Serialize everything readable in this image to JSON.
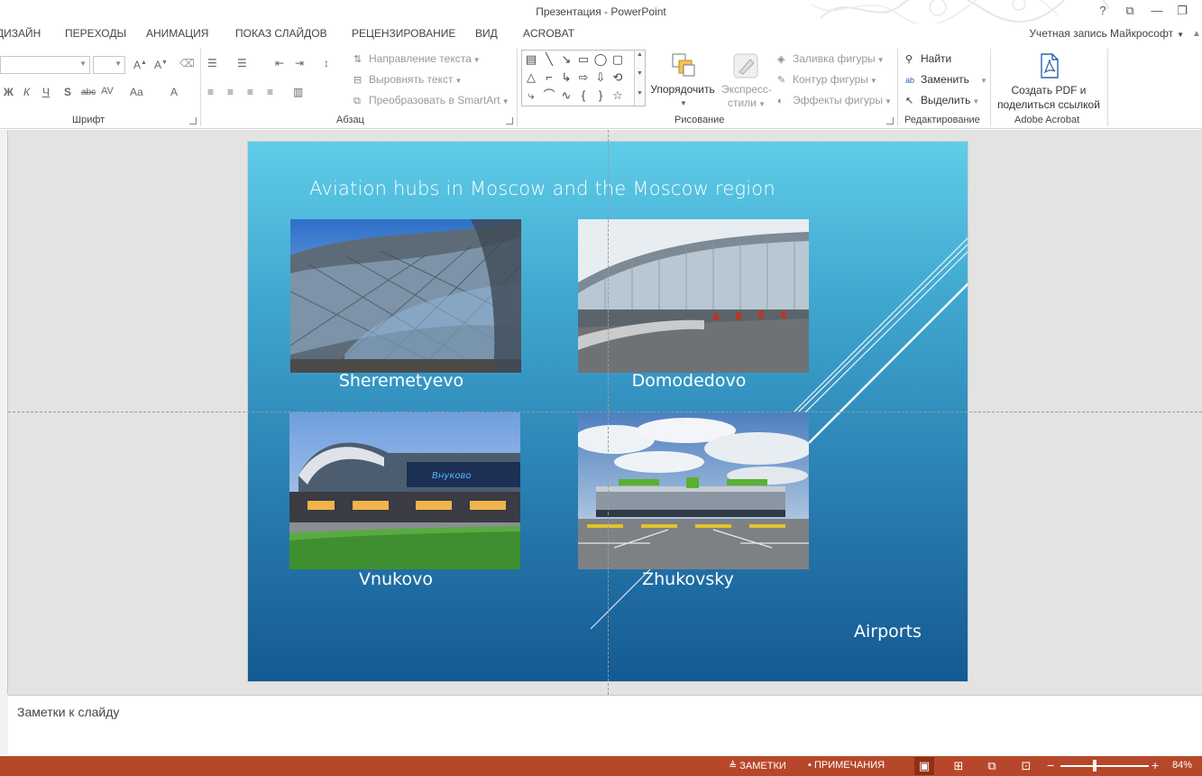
{
  "window": {
    "title": "Презентация - PowerPoint",
    "controls": [
      "?",
      "⧉",
      "—",
      "❐"
    ]
  },
  "ribbon_tabs": [
    "ДИЗАЙН",
    "ПЕРЕХОДЫ",
    "АНИМАЦИЯ",
    "ПОКАЗ СЛАЙДОВ",
    "РЕЦЕНЗИРОВАНИЕ",
    "ВИД",
    "ACROBAT"
  ],
  "account": "Учетная запись Майкрософт",
  "font_group": {
    "label": "Шрифт",
    "buttons": [
      "Ж",
      "К",
      "Ч",
      "S",
      "abc",
      "AV",
      "Aa",
      "A"
    ]
  },
  "paragraph_group": {
    "label": "Абзац",
    "text_direction": "Направление текста",
    "align_text": "Выровнять текст",
    "smartart": "Преобразовать в SmartArt"
  },
  "drawing_group": {
    "label": "Рисование",
    "arrange": "Упорядочить",
    "quick_styles": "Экспресс-стили",
    "quick_styles_line1": "Экспресс-",
    "quick_styles_line2": "стили",
    "shape_fill": "Заливка фигуры",
    "shape_outline": "Контур фигуры",
    "shape_effects": "Эффекты фигуры"
  },
  "editing_group": {
    "label": "Редактирование",
    "find": "Найти",
    "replace": "Заменить",
    "select": "Выделить"
  },
  "acrobat_group": {
    "label": "Adobe Acrobat",
    "button_line1": "Создать PDF и",
    "button_line2": "поделиться ссылкой"
  },
  "slide": {
    "title": "Aviation hubs in Moscow and the Moscow region",
    "airports": [
      {
        "name": "Sheremetyevo",
        "photo_sign": ""
      },
      {
        "name": "Domodedovo",
        "photo_sign": ""
      },
      {
        "name": "Vnukovo",
        "photo_sign": "Внуково"
      },
      {
        "name": "Zhukovsky",
        "photo_sign": ""
      }
    ],
    "footer_label": "Airports"
  },
  "notes": {
    "placeholder": "Заметки к слайду"
  },
  "statusbar": {
    "notes": "ЗАМЕТКИ",
    "comments": "ПРИМЕЧАНИЯ",
    "zoom": "84%"
  },
  "colors": {
    "accent": "#b7472a",
    "slide_top": "#5fcde8",
    "slide_bottom": "#145a93"
  }
}
